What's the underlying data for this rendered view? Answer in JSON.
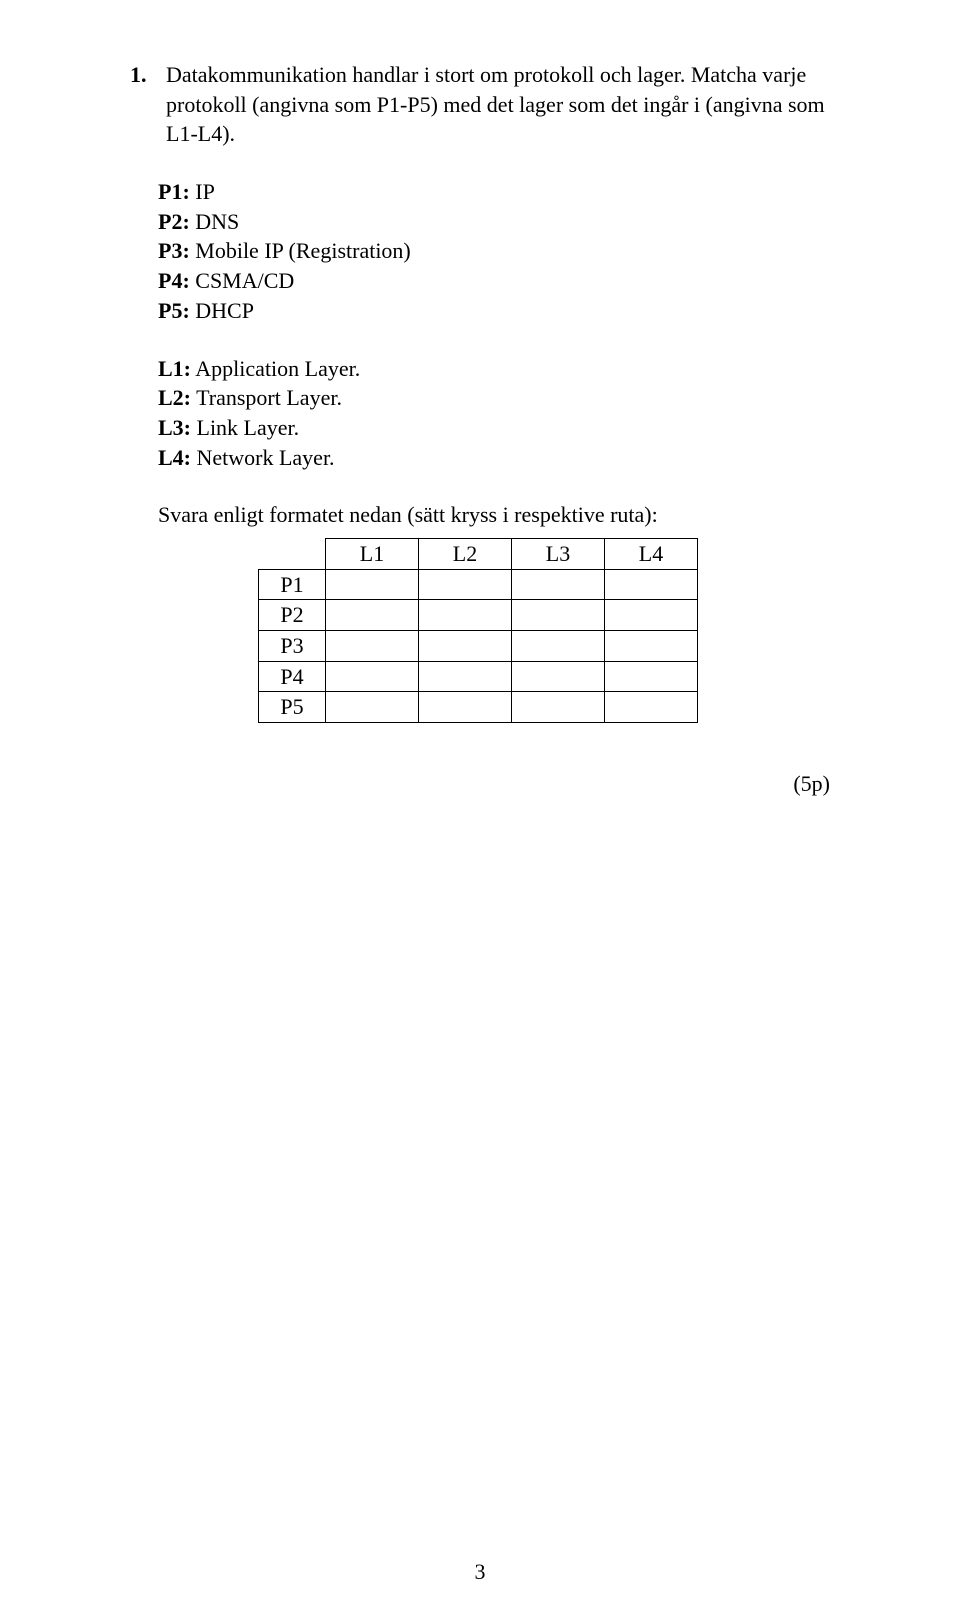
{
  "question": {
    "number": "1.",
    "intro_a": "Datakommunikation handlar i stort om protokoll och lager. Matcha varje protokoll (angivna som P1-P5) med det lager som det ingår i (angivna som L1-L4)."
  },
  "protocols": {
    "p1_label": "P1:",
    "p1_val": "IP",
    "p2_label": "P2:",
    "p2_val": "DNS",
    "p3_label": "P3:",
    "p3_val": "Mobile IP (Registration)",
    "p4_label": "P4:",
    "p4_val": "CSMA/CD",
    "p5_label": "P5:",
    "p5_val": "DHCP"
  },
  "layers": {
    "l1_label": "L1:",
    "l1_val": "Application Layer.",
    "l2_label": "L2:",
    "l2_val": "Transport Layer.",
    "l3_label": "L3:",
    "l3_val": "Link Layer.",
    "l4_label": "L4:",
    "l4_val": "Network Layer."
  },
  "answer_instructions": "Svara enligt formatet nedan (sätt kryss i respektive ruta):",
  "table": {
    "col1": "L1",
    "col2": "L2",
    "col3": "L3",
    "col4": "L4",
    "row1": "P1",
    "row2": "P2",
    "row3": "P3",
    "row4": "P4",
    "row5": "P5"
  },
  "points": "(5p)",
  "page_number": "3"
}
